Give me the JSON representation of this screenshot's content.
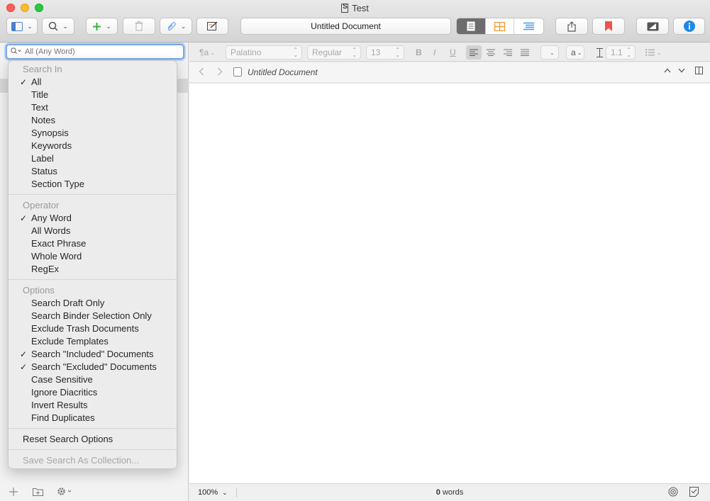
{
  "window": {
    "title": "Test"
  },
  "toolbar": {
    "document_title": "Untitled Document",
    "colors": {
      "view_active": "#6c6c6c",
      "corkboard": "#f0932b",
      "outline": "#3d9be9",
      "add": "#31b43c",
      "bookmark": "#ef5350",
      "inspector": "#1e88e5"
    }
  },
  "format_bar": {
    "paragraph_glyph": "¶a",
    "font_family": "Palatino",
    "font_style": "Regular",
    "font_size": "13",
    "bold": "B",
    "italic": "I",
    "underline": "U",
    "highlight": "a",
    "line_spacing": "1.1"
  },
  "search": {
    "placeholder": "All (Any Word)"
  },
  "search_menu": {
    "search_in_header": "Search In",
    "search_in": [
      {
        "label": "All",
        "checked": true
      },
      {
        "label": "Title",
        "checked": false
      },
      {
        "label": "Text",
        "checked": false
      },
      {
        "label": "Notes",
        "checked": false
      },
      {
        "label": "Synopsis",
        "checked": false
      },
      {
        "label": "Keywords",
        "checked": false
      },
      {
        "label": "Label",
        "checked": false
      },
      {
        "label": "Status",
        "checked": false
      },
      {
        "label": "Section Type",
        "checked": false
      }
    ],
    "operator_header": "Operator",
    "operators": [
      {
        "label": "Any Word",
        "checked": true
      },
      {
        "label": "All Words",
        "checked": false
      },
      {
        "label": "Exact Phrase",
        "checked": false
      },
      {
        "label": "Whole Word",
        "checked": false
      },
      {
        "label": "RegEx",
        "checked": false
      }
    ],
    "options_header": "Options",
    "options": [
      {
        "label": "Search Draft Only",
        "checked": false
      },
      {
        "label": "Search Binder Selection Only",
        "checked": false
      },
      {
        "label": "Exclude Trash Documents",
        "checked": false
      },
      {
        "label": "Exclude Templates",
        "checked": false
      },
      {
        "label": "Search \"Included\" Documents",
        "checked": true
      },
      {
        "label": "Search \"Excluded\" Documents",
        "checked": true
      },
      {
        "label": "Case Sensitive",
        "checked": false
      },
      {
        "label": "Ignore Diacritics",
        "checked": false
      },
      {
        "label": "Invert Results",
        "checked": false
      },
      {
        "label": "Find Duplicates",
        "checked": false
      }
    ],
    "reset_label": "Reset Search Options",
    "save_label": "Save Search As Collection...",
    "checkmark": "✓"
  },
  "editor": {
    "document_name": "Untitled Document"
  },
  "status_bar": {
    "zoom": "100%",
    "word_count": "0",
    "word_label": "words"
  }
}
